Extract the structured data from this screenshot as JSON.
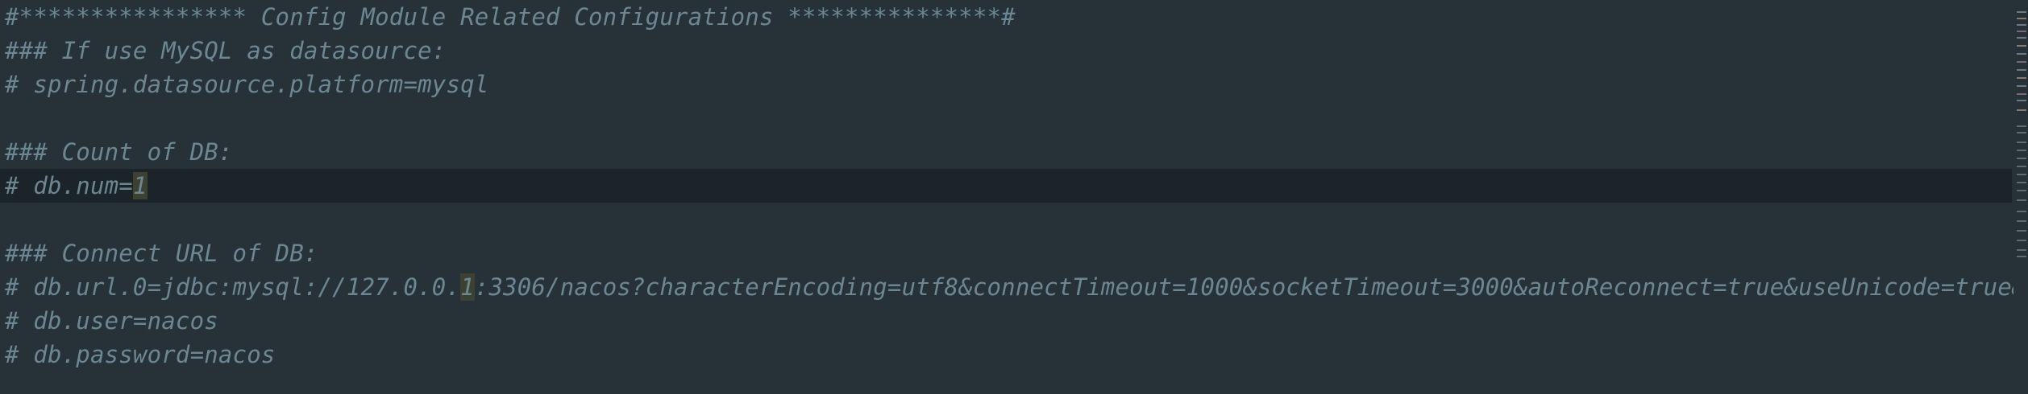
{
  "editor": {
    "lines": [
      {
        "segments": [
          {
            "text": "#**************** Config Module Related Configurations ***************#"
          }
        ]
      },
      {
        "segments": [
          {
            "text": "### If use MySQL as datasource:"
          }
        ]
      },
      {
        "segments": [
          {
            "text": "# spring.datasource.platform=mysql"
          }
        ]
      },
      {
        "segments": []
      },
      {
        "segments": [
          {
            "text": "### Count of DB:"
          }
        ]
      },
      {
        "segments": [
          {
            "text": "# db.num="
          },
          {
            "text": "1"
          }
        ]
      },
      {
        "segments": []
      },
      {
        "segments": [
          {
            "text": "### Connect URL of DB:"
          }
        ]
      },
      {
        "segments": [
          {
            "text": "# db.url.0=jdbc:mysql://127.0.0."
          },
          {
            "text": "1"
          },
          {
            "text": ":3306/nacos?characterEncoding=utf8&connectTimeout=1000&socketTimeout=3000&autoReconnect=true&useUnicode=true&useSSL"
          }
        ]
      },
      {
        "segments": [
          {
            "text": "# db.user=nacos"
          }
        ]
      },
      {
        "segments": [
          {
            "text": "# db.password=nacos"
          }
        ]
      }
    ]
  },
  "colors": {
    "background": "#263238",
    "current_line": "#1b2428",
    "comment_text": "#6c8793",
    "match_highlight": "#3d4131"
  }
}
